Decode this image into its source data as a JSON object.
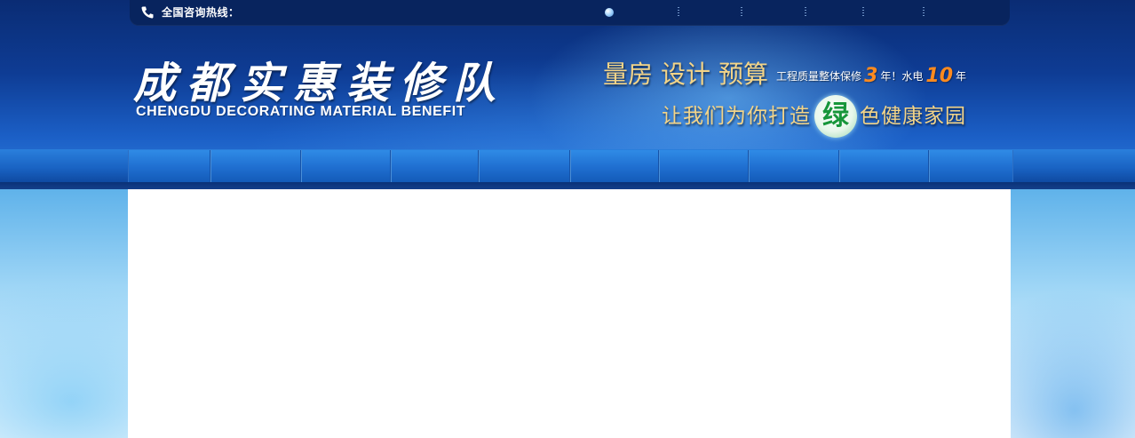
{
  "topbar": {
    "hotline_label": "全国咨询热线："
  },
  "logo": {
    "chinese": "成都实惠装修队",
    "english": "CHENGDU DECORATING MATERIAL BENEFIT"
  },
  "slogans": {
    "services": [
      "量房",
      "设计",
      "预算"
    ],
    "warranty_prefix": "工程质量整体保修",
    "warranty_years": "3",
    "warranty_mid": "年！水电",
    "plumbing_years": "10",
    "warranty_suffix": "年",
    "tagline_prefix": "让我们为你打造",
    "tagline_highlight": "绿",
    "tagline_suffix": "色健康家园"
  },
  "nav": {
    "item_count": 10
  },
  "colors": {
    "header_dark": "#0a2c74",
    "header_light": "#2d7ad9",
    "gold": "#f3d488",
    "orange": "#ff8a1e",
    "green": "#17963a",
    "content_bg": "#ffffff"
  },
  "icons": {
    "hotline": "phone-icon",
    "bullet": "bullet-dot"
  }
}
